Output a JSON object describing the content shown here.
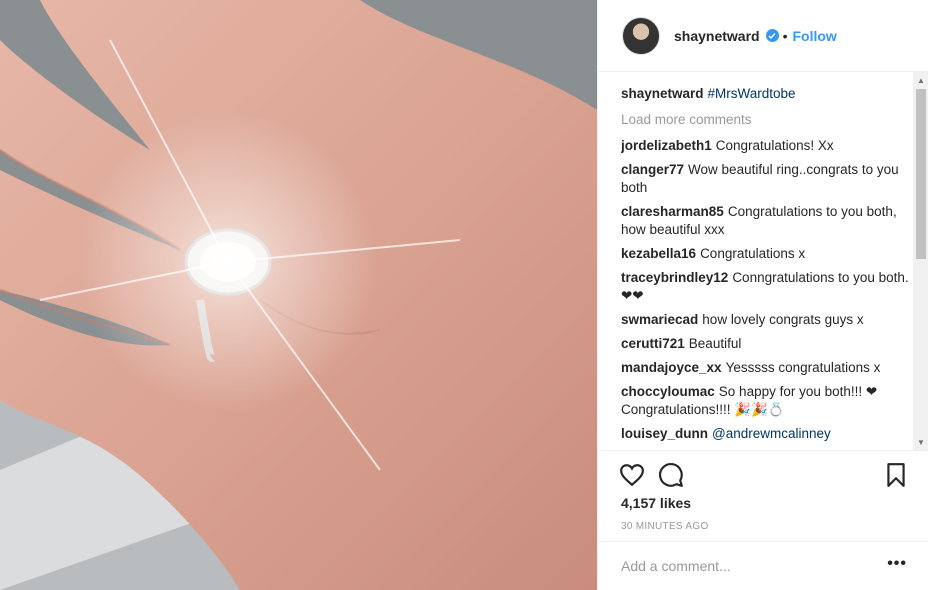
{
  "post": {
    "image_alt": "Hand with engagement ring",
    "author": "shaynetward",
    "follow_label": "Follow",
    "separator": "•",
    "caption_user": "shaynetward",
    "caption_tag": "#MrsWardtobe",
    "load_more": "Load more comments",
    "comments": [
      {
        "user": "jordelizabeth1",
        "text": "Congratulations! Xx"
      },
      {
        "user": "clanger77",
        "text": "Wow beautiful ring..congrats to you both"
      },
      {
        "user": "claresharman85",
        "text": "Congratulations to you both, how beautiful xxx"
      },
      {
        "user": "kezabella16",
        "text": "Congratulations x"
      },
      {
        "user": "traceybrindley12",
        "text": "Conngratulations to you both.❤❤"
      },
      {
        "user": "swmariecad",
        "text": "how lovely congrats guys x"
      },
      {
        "user": "cerutti721",
        "text": "Beautiful"
      },
      {
        "user": "mandajoyce_xx",
        "text": "Yesssss congratulations x"
      },
      {
        "user": "choccyloumac",
        "text": "So happy for you both!!! ❤ Congratulations!!!! 🎉🎉💍"
      },
      {
        "user": "louisey_dunn",
        "text": "",
        "mention": "@andrewmcalinney"
      }
    ],
    "likes": "4,157 likes",
    "time": "30 MINUTES AGO",
    "add_comment_placeholder": "Add a comment...",
    "more_label": "•••",
    "icons": {
      "like": "heart-icon",
      "comment": "comment-icon",
      "save": "bookmark-icon",
      "verified": "verified-badge-icon"
    },
    "colors": {
      "link": "#3897f0",
      "hashtag": "#003569",
      "muted": "#999999"
    }
  }
}
